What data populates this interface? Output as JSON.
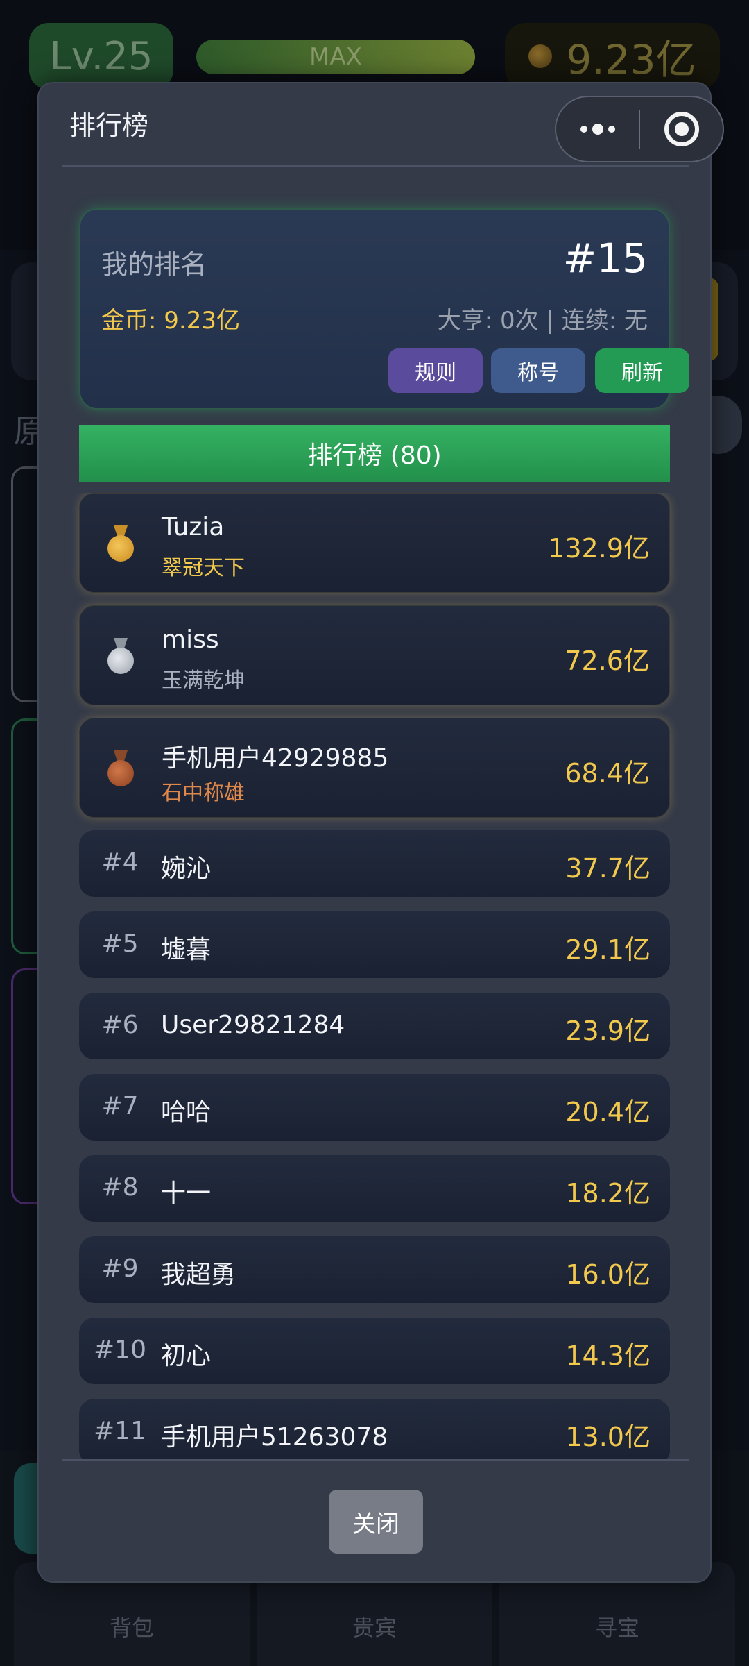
{
  "background": {
    "level": "Lv.25",
    "exp_label": "MAX",
    "coins": "9.23亿",
    "side_char": "原",
    "nav": [
      "背包",
      "贵宾",
      "寻宝"
    ]
  },
  "modal": {
    "title": "排行榜",
    "my_rank": {
      "label": "我的排名",
      "rank": "#15",
      "coins": "金币: 9.23亿",
      "stats": "大亨: 0次 | 连续: 无",
      "buttons": {
        "rules": "规则",
        "title": "称号",
        "refresh": "刷新"
      }
    },
    "leaderboard_header": "排行榜 (80)",
    "top3": [
      {
        "medal": "gold-medal-icon",
        "name": "Tuzia",
        "title": "翠冠天下",
        "score": "132.9亿"
      },
      {
        "medal": "silver-medal-icon",
        "name": "miss",
        "title": "玉满乾坤",
        "score": "72.6亿"
      },
      {
        "medal": "bronze-medal-icon",
        "name": "手机用户42929885",
        "title": "石中称雄",
        "score": "68.4亿"
      }
    ],
    "rows": [
      {
        "rank": "#4",
        "name": "婉沁",
        "score": "37.7亿"
      },
      {
        "rank": "#5",
        "name": "墟暮",
        "score": "29.1亿"
      },
      {
        "rank": "#6",
        "name": "User29821284",
        "score": "23.9亿"
      },
      {
        "rank": "#7",
        "name": "哈哈",
        "score": "20.4亿"
      },
      {
        "rank": "#8",
        "name": "十一",
        "score": "18.2亿"
      },
      {
        "rank": "#9",
        "name": "我超勇",
        "score": "16.0亿"
      },
      {
        "rank": "#10",
        "name": "初心",
        "score": "14.3亿"
      },
      {
        "rank": "#11",
        "name": "手机用户51263078",
        "score": "13.0亿"
      }
    ],
    "close_label": "关闭"
  },
  "colors": {
    "accent_green": "#239b55",
    "gold_text": "#f2c94c",
    "modal_bg": "#343a48"
  }
}
